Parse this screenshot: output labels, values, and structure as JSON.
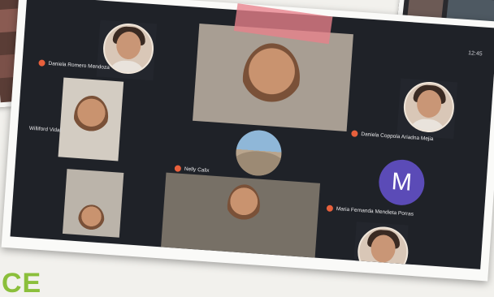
{
  "participants": [
    {
      "name": "Daniela Romero Mendoza",
      "dot_color": "#e8603c"
    },
    {
      "name": "Daniela Coppola Ariadna Mejia",
      "dot_color": "#e8603c"
    },
    {
      "name": "Williford Vidal",
      "dot_color": "#e8603c"
    },
    {
      "name": "Nelly Calix",
      "dot_color": "#e8603c"
    },
    {
      "name": "Maria Fernanda Mendieta Porras",
      "dot_color": "#e8603c"
    }
  ],
  "avatars": {
    "letter": "M",
    "letter_color": "#5b4bb7"
  },
  "controls": "12:45",
  "logo_text": "CE",
  "accent_colors": {
    "tape": "#e8808a",
    "background": "#1f2228",
    "logo": "#8bbf3b"
  }
}
